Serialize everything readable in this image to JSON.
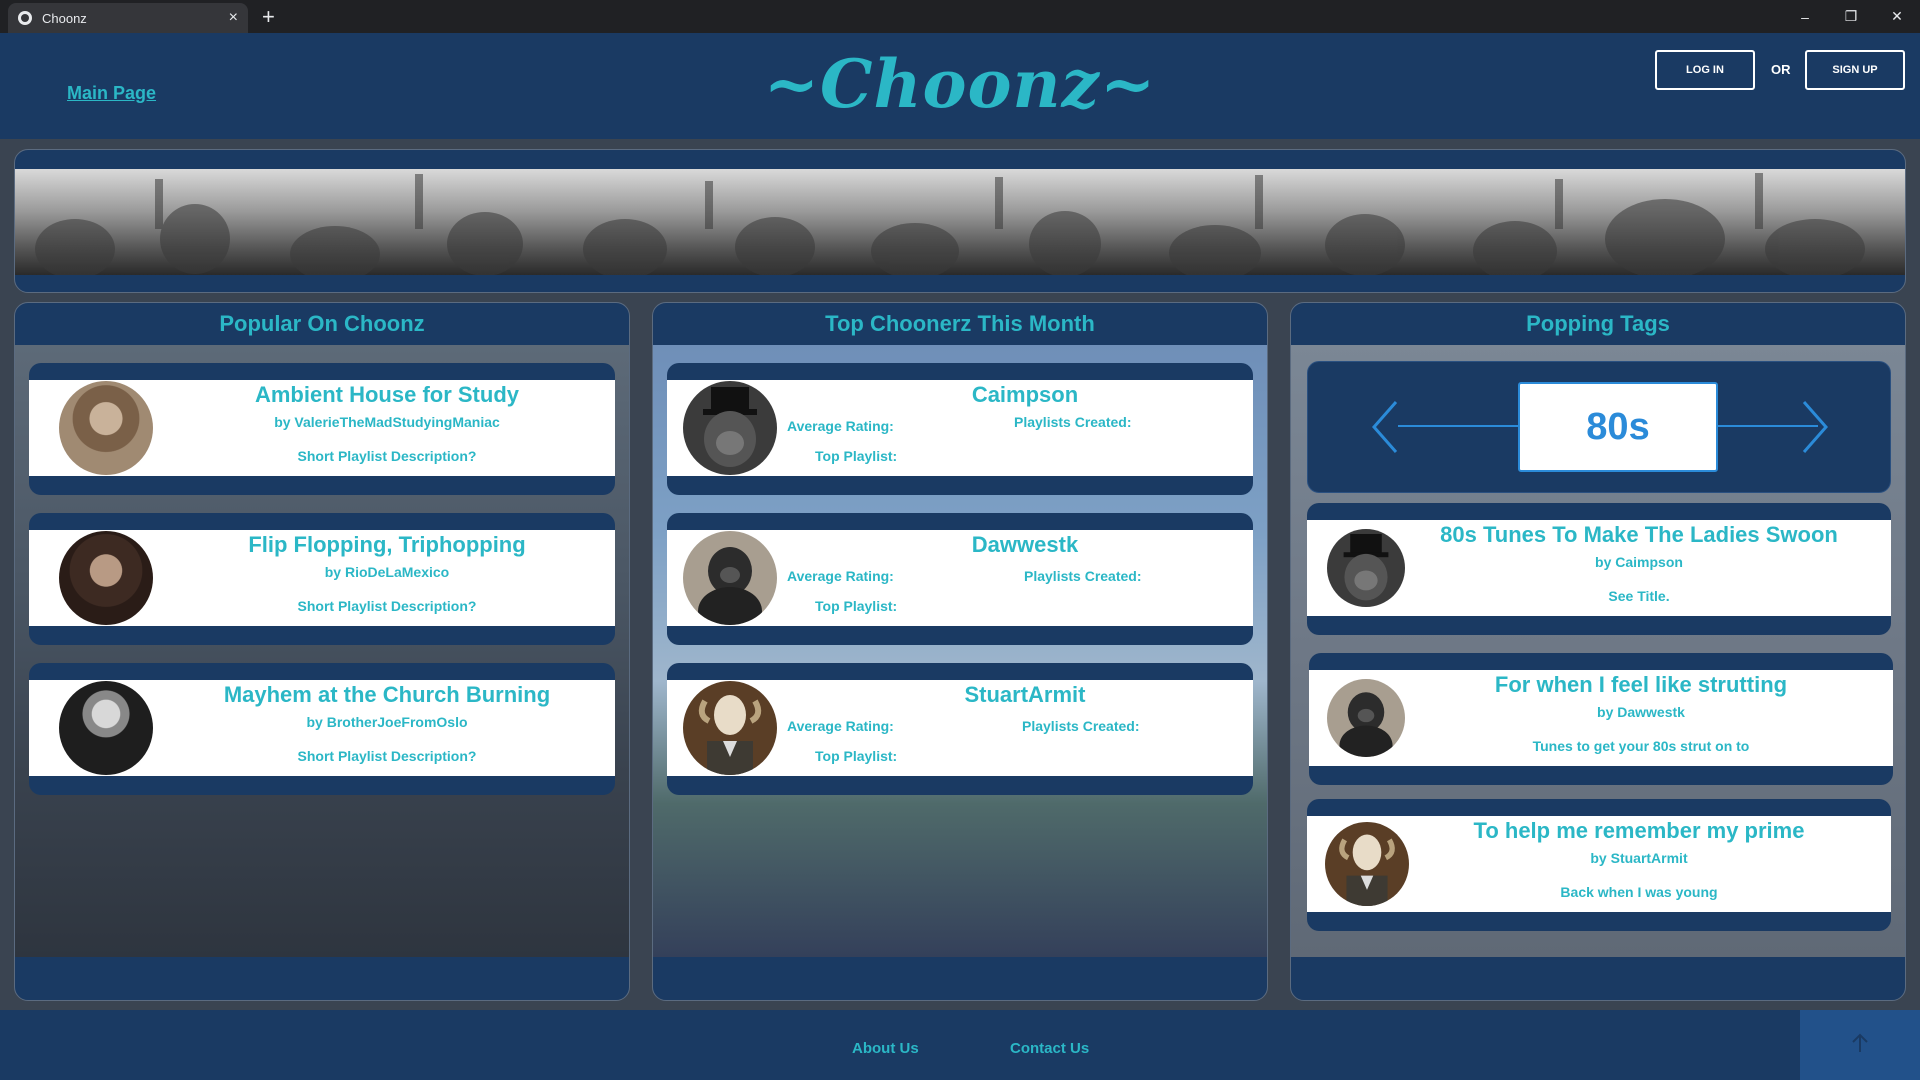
{
  "browser": {
    "tab_title": "Choonz",
    "new_tab": "+",
    "close_tab": "×",
    "minimize": "–",
    "restore": "❐",
    "close_window": "✕"
  },
  "header": {
    "main_link": "Main Page",
    "logo": "~Choonz~",
    "login_label": "LOG IN",
    "or_label": "OR",
    "signup_label": "SIGN UP"
  },
  "popular": {
    "title": "Popular On Choonz",
    "cards": [
      {
        "title": "Ambient House for Study",
        "by": "by ValerieTheMadStudyingManiac",
        "desc": "Short Playlist Description?"
      },
      {
        "title": "Flip Flopping, Triphopping",
        "by": "by RioDeLaMexico",
        "desc": "Short Playlist Description?"
      },
      {
        "title": "Mayhem at the Church Burning",
        "by": "by BrotherJoeFromOslo",
        "desc": "Short Playlist Description?"
      }
    ]
  },
  "top_users": {
    "title": "Top Choonerz This Month",
    "avg_label": "Average Rating:",
    "created_label": "Playlists Created:",
    "top_label": "Top Playlist:",
    "users": [
      {
        "name": "Caimpson"
      },
      {
        "name": "Dawwestk"
      },
      {
        "name": "StuartArmit"
      }
    ]
  },
  "tags": {
    "title": "Popping Tags",
    "current_tag": "80s",
    "cards": [
      {
        "title": "80s Tunes To Make The Ladies Swoon",
        "by": "by Caimpson",
        "desc": "See Title."
      },
      {
        "title": "For when I feel  like strutting",
        "by": "by Dawwestk",
        "desc": "Tunes to get your 80s strut on to"
      },
      {
        "title": "To help me remember my prime",
        "by": "by StuartArmit",
        "desc": "Back when I was young"
      }
    ]
  },
  "footer": {
    "about": "About Us",
    "contact": "Contact Us"
  },
  "colors": {
    "navy": "#1a3a63",
    "accent": "#2bb7c6",
    "tag_blue": "#2b8bd9"
  }
}
